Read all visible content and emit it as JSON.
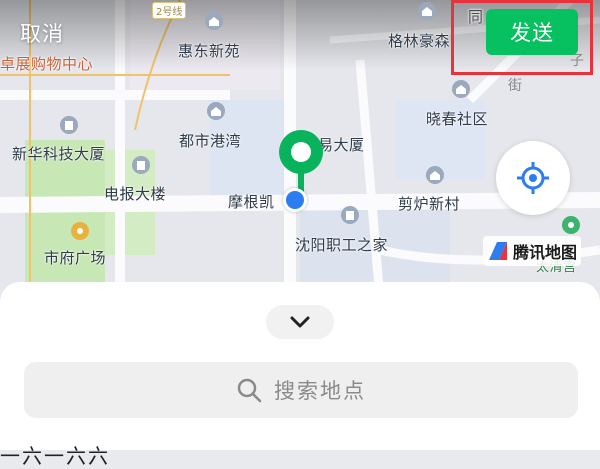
{
  "header": {
    "cancel_label": "取消",
    "send_label": "发送"
  },
  "map": {
    "labels": {
      "huidong": "惠东新苑",
      "gelin": "格林豪森",
      "zhanjia": "卓展购物中心",
      "xiaochun": "晓春社区",
      "xinhua": "新华科技大厦",
      "dushi": "都市港湾",
      "maoyi": "易大厦",
      "dianbao": "电报大楼",
      "mogen": "摩根凯",
      "jianlu": "剪炉新村",
      "shifu": "市府广场",
      "shenyang": "沈阳职工之家",
      "taiqing": "太清宫",
      "tong": "同",
      "metro": "2号线",
      "street": "街",
      "street2": "子"
    },
    "brand": "腾讯地图",
    "accent_send": "#07c160",
    "highlight_border": "#e8323c",
    "pin_color": "#08b35b",
    "my_location_color": "#2b7df0"
  },
  "search": {
    "placeholder": "搜索地点"
  },
  "sheet": {
    "partial_text": "一六一六六"
  }
}
